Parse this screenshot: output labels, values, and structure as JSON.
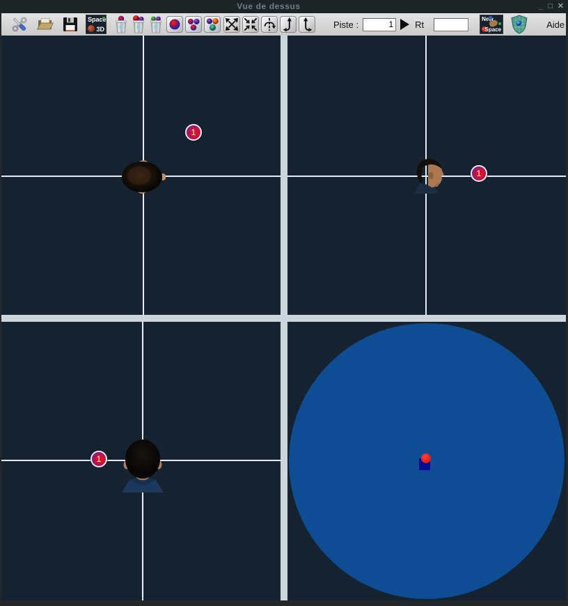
{
  "window": {
    "title": "Vue de dessus",
    "minimize": "_",
    "maximize": "□",
    "close": "✕"
  },
  "toolbar": {
    "icons": [
      "tools",
      "open-folder",
      "save-floppy",
      "space-3d",
      "trash-source-1",
      "trash-source-2",
      "trash-source-3",
      "single-source",
      "three-sources",
      "multi-sources",
      "expand-view",
      "contract-view",
      "rotate-axis",
      "rotate-down-left",
      "rotate-down-right",
      "play",
      "new-space",
      "shield"
    ],
    "space3d_line1": "Space",
    "space3d_line2": "3D",
    "piste_label": "Piste :",
    "piste_value": "1",
    "rt_label": "Rt",
    "rt_value": "",
    "newspace_line1": "New",
    "newspace_line2": "Space",
    "aide_label": "Aide"
  },
  "views": {
    "top_left": {
      "marker_label": "1"
    },
    "top_right": {
      "marker_label": "1"
    },
    "bottom_left": {
      "marker_label": "1"
    }
  },
  "colors": {
    "titlebar_bg": "#1d2427",
    "title_text": "#707e88",
    "window_frame": "#23282b",
    "quadrant_bg": "#152330",
    "crosshair": "#e7edf3",
    "separator": "#ccd5dc",
    "disc": "#0e4d94",
    "marker_red": "#cf1038",
    "marker_blue": "#3527c9"
  }
}
